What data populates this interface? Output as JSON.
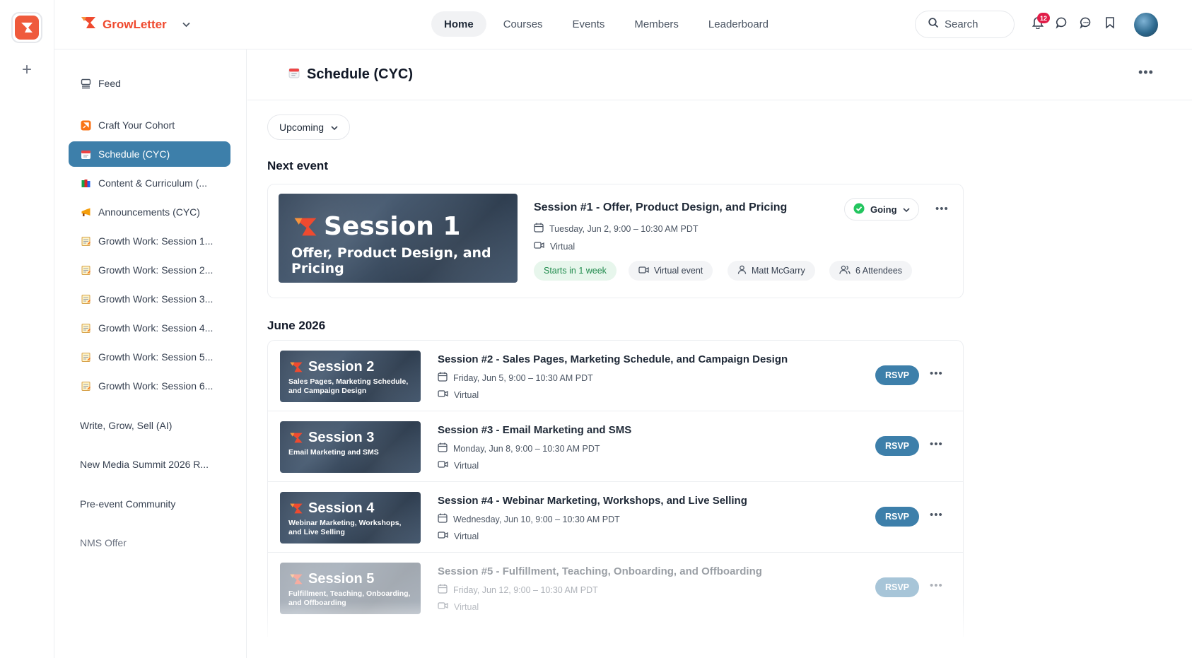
{
  "brand": {
    "name": "GrowLetter"
  },
  "nav": [
    {
      "label": "Home",
      "active": true
    },
    {
      "label": "Courses"
    },
    {
      "label": "Events"
    },
    {
      "label": "Members"
    },
    {
      "label": "Leaderboard"
    }
  ],
  "header": {
    "search_label": "Search",
    "notification_count": "12"
  },
  "sidebar": {
    "feed": "Feed",
    "items": [
      {
        "label": "Craft Your Cohort",
        "icon": "rocket-icon"
      },
      {
        "label": "Schedule (CYC)",
        "icon": "calendar-icon",
        "active": true
      },
      {
        "label": "Content & Curriculum (...",
        "icon": "books-icon"
      },
      {
        "label": "Announcements (CYC)",
        "icon": "megaphone-icon"
      },
      {
        "label": "Growth Work: Session 1...",
        "icon": "memo-icon"
      },
      {
        "label": "Growth Work: Session 2...",
        "icon": "memo-icon"
      },
      {
        "label": "Growth Work: Session 3...",
        "icon": "memo-icon"
      },
      {
        "label": "Growth Work: Session 4...",
        "icon": "memo-icon"
      },
      {
        "label": "Growth Work: Session 5...",
        "icon": "memo-icon"
      },
      {
        "label": "Growth Work: Session 6...",
        "icon": "memo-icon"
      }
    ],
    "groups": [
      "Write, Grow, Sell (AI)",
      "New Media Summit 2026 R...",
      "Pre-event Community",
      "NMS Offer"
    ]
  },
  "page": {
    "title": "Schedule (CYC)",
    "filter": "Upcoming",
    "next_event_heading": "Next event",
    "month_heading": "June 2026"
  },
  "next_event": {
    "thumb_title": "Session 1",
    "thumb_sub": "Offer, Product Design, and Pricing",
    "title": "Session #1 - Offer, Product Design, and Pricing",
    "date": "Tuesday, Jun 2, 9:00 – 10:30 AM PDT",
    "location": "Virtual",
    "rsvp_status": "Going",
    "pills": {
      "starts": "Starts in 1 week",
      "type": "Virtual event",
      "host": "Matt McGarry",
      "attendees": "6 Attendees"
    }
  },
  "events": [
    {
      "thumb_title": "Session 2",
      "thumb_sub": "Sales Pages, Marketing Schedule, and Campaign Design",
      "title": "Session #2 - Sales Pages, Marketing Schedule, and Campaign Design",
      "date": "Friday, Jun 5, 9:00 – 10:30 AM PDT",
      "location": "Virtual",
      "rsvp": "RSVP"
    },
    {
      "thumb_title": "Session 3",
      "thumb_sub": "Email Marketing and SMS",
      "title": "Session #3 - Email Marketing and SMS",
      "date": "Monday, Jun 8, 9:00 – 10:30 AM PDT",
      "location": "Virtual",
      "rsvp": "RSVP"
    },
    {
      "thumb_title": "Session 4",
      "thumb_sub": "Webinar Marketing, Workshops, and Live Selling",
      "title": "Session #4 - Webinar Marketing, Workshops, and Live Selling",
      "date": "Wednesday, Jun 10, 9:00 – 10:30 AM PDT",
      "location": "Virtual",
      "rsvp": "RSVP"
    },
    {
      "thumb_title": "Session 5",
      "thumb_sub": "Fulfillment, Teaching, Onboarding, and Offboarding",
      "title": "Session #5 - Fulfillment, Teaching, Onboarding, and Offboarding",
      "date": "Friday, Jun 12, 9:00 – 10:30 AM PDT",
      "location": "Virtual",
      "rsvp": "RSVP"
    }
  ],
  "colors": {
    "brand": "#ef4a2f",
    "accent": "#3d7faa",
    "going_check": "#22c55e",
    "notification": "#e11d48"
  }
}
